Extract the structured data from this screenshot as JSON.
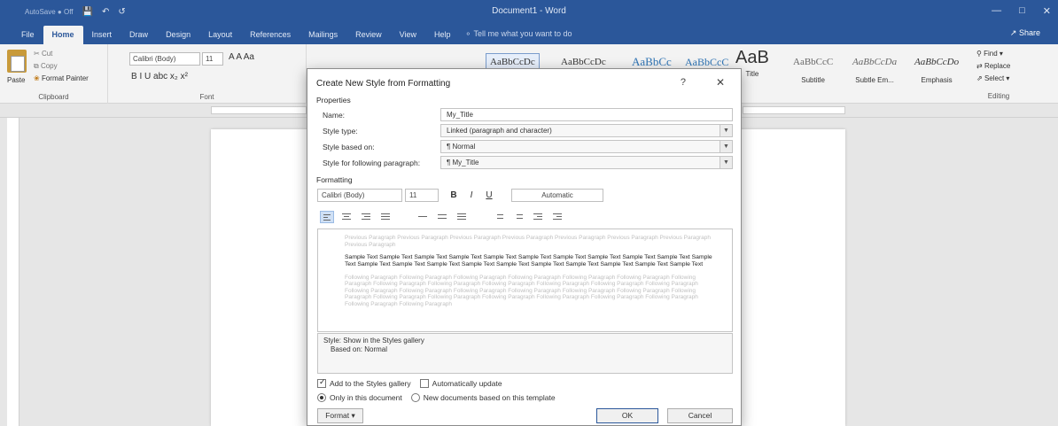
{
  "window": {
    "autosave": "AutoSave ● Off",
    "title": "Document1 - Word",
    "controls": [
      "—",
      "□",
      "✕"
    ]
  },
  "ribbon_tabs": [
    "File",
    "Home",
    "Insert",
    "Draw",
    "Design",
    "Layout",
    "References",
    "Mailings",
    "Review",
    "View",
    "Help"
  ],
  "tell_me": "Tell me what you want to do",
  "share": "Share",
  "clipboard": {
    "paste": "Paste",
    "cut": "Cut",
    "copy": "Copy",
    "format_painter": "Format Painter",
    "label": "Clipboard"
  },
  "font_group": {
    "font_name": "Calibri (Body)",
    "font_size": "11",
    "row1": "A  A   Aa",
    "row2": "B  I  U  abc  x₂  x²",
    "label": "Font"
  },
  "styles_gallery": [
    {
      "sample": "AaBbCcDc",
      "name": "",
      "selected": true
    },
    {
      "sample": "AaBbCcDc",
      "name": ""
    },
    {
      "sample": "AaBbCc",
      "name": ""
    },
    {
      "sample": "AaBbCcC",
      "name": ""
    },
    {
      "sample": "AaB",
      "name": "Title"
    },
    {
      "sample": "AaBbCcC",
      "name": "Subtitle"
    },
    {
      "sample": "AaBbCcDa",
      "name": "Subtle Em..."
    },
    {
      "sample": "AaBbCcDo",
      "name": "Emphasis"
    }
  ],
  "editing": {
    "find": "Find",
    "replace": "Replace",
    "select": "Select",
    "label": "Editing"
  },
  "dialog": {
    "title": "Create New Style from Formatting",
    "help": "?",
    "close": "✕",
    "properties_heading": "Properties",
    "props": [
      {
        "label": "Name:",
        "value": "My_Title",
        "combo": false
      },
      {
        "label": "Style type:",
        "value": "Linked (paragraph and character)",
        "combo": true
      },
      {
        "label": "Style based on:",
        "value": "¶ Normal",
        "combo": true
      },
      {
        "label": "Style for following paragraph:",
        "value": "¶ My_Title",
        "combo": true
      }
    ],
    "formatting_heading": "Formatting",
    "font": "Calibri (Body)",
    "size": "11",
    "bold": "B",
    "italic": "I",
    "underline": "U",
    "color": "Automatic",
    "preview_previous": "Previous Paragraph Previous Paragraph Previous Paragraph Previous Paragraph Previous Paragraph Previous Paragraph Previous Paragraph Previous Paragraph",
    "preview_sample": "Sample Text Sample Text Sample Text Sample Text Sample Text Sample Text Sample Text Sample Text Sample Text Sample Text Sample Text Sample Text Sample Text Sample Text Sample Text Sample Text Sample Text Sample Text Sample Text Sample Text Sample Text",
    "preview_following": "Following Paragraph Following Paragraph Following Paragraph Following Paragraph Following Paragraph Following Paragraph Following Paragraph Following Paragraph Following Paragraph Following Paragraph Following Paragraph Following Paragraph Following Paragraph Following Paragraph Following Paragraph Following Paragraph Following Paragraph Following Paragraph Following Paragraph Following Paragraph Following Paragraph Following Paragraph Following Paragraph Following Paragraph Following Paragraph Following Paragraph Following Paragraph Following Paragraph",
    "description_line1": "Style: Show in the Styles gallery",
    "description_line2": "Based on: Normal",
    "add_to_gallery": "Add to the Styles gallery",
    "auto_update": "Automatically update",
    "only_this_doc": "Only in this document",
    "new_docs_template": "New documents based on this template",
    "format_button": "Format ▾",
    "ok": "OK",
    "cancel": "Cancel"
  }
}
